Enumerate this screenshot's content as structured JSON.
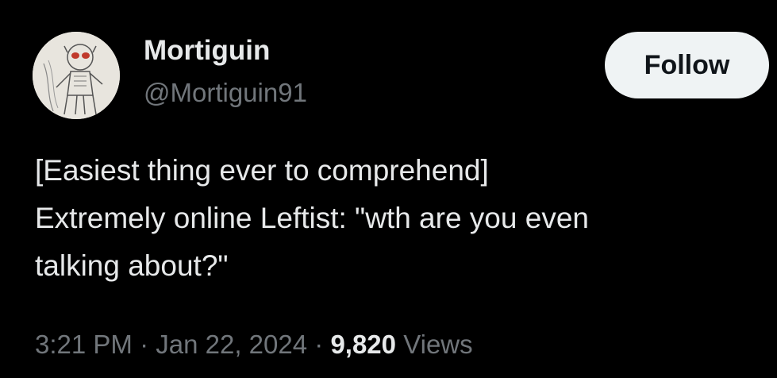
{
  "user": {
    "display_name": "Mortiguin",
    "handle": "@Mortiguin91",
    "avatar_icon": "avatar-sketch-icon"
  },
  "follow_button": {
    "label": "Follow"
  },
  "tweet": {
    "lines": [
      "[Easiest thing ever to comprehend]",
      "Extremely online Leftist: \"wth are you even",
      "talking about?\""
    ]
  },
  "meta": {
    "time": "3:21 PM",
    "separator": "·",
    "date": "Jan 22, 2024",
    "views_count": "9,820",
    "views_label": "Views"
  },
  "colors": {
    "background": "#000000",
    "primary_text": "#e7e9ea",
    "secondary_text": "#71767b",
    "follow_bg": "#eff3f4",
    "follow_text": "#0f1419"
  }
}
